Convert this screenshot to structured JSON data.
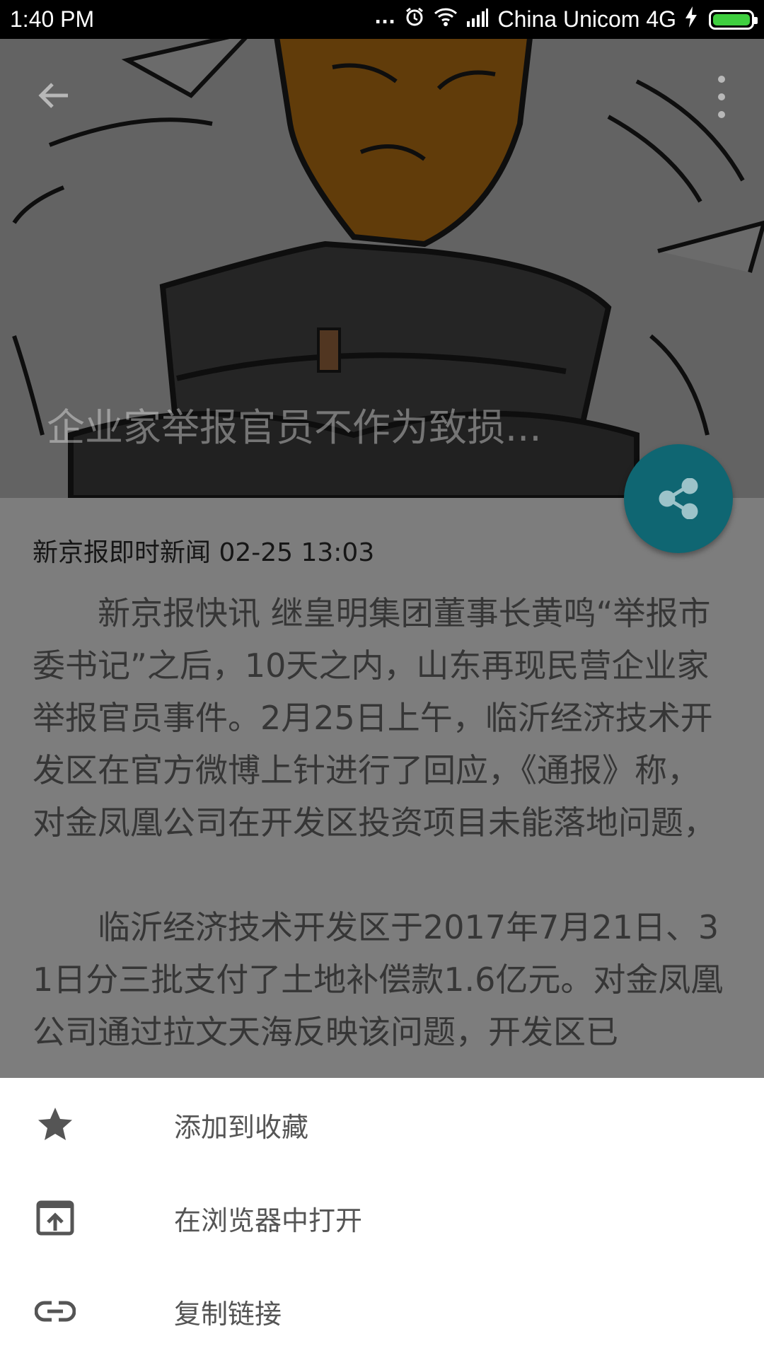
{
  "status_bar": {
    "time": "1:40 PM",
    "more_dots": "...",
    "carrier": "China Unicom 4G"
  },
  "hero": {
    "title": "企业家举报官员不作为致损..."
  },
  "article": {
    "meta": "新京报即时新闻 02-25 13:03",
    "paragraphs": [
      "新京报快讯 继皇明集团董事长黄鸣“举报市委书记”之后，10天之内，山东再现民营企业家举报官员事件。2月25日上午，临沂经济技术开发区在官方微博上针进行了回应，《通报》称，对金凤凰公司在开发区投资项目未能落地问题，",
      "临沂经济技术开发区于2017年7月21日、31日分三批支付了土地补偿款1.6亿元。对金凤凰公司通过拉文天海反映该问题，开发区已"
    ]
  },
  "sheet": {
    "items": [
      {
        "label": "添加到收藏",
        "icon": "star-icon"
      },
      {
        "label": "在浏览器中打开",
        "icon": "open-in-browser-icon"
      },
      {
        "label": "复制链接",
        "icon": "link-icon"
      }
    ]
  },
  "colors": {
    "fab": "#0f6672",
    "battery": "#3fcf3f"
  }
}
